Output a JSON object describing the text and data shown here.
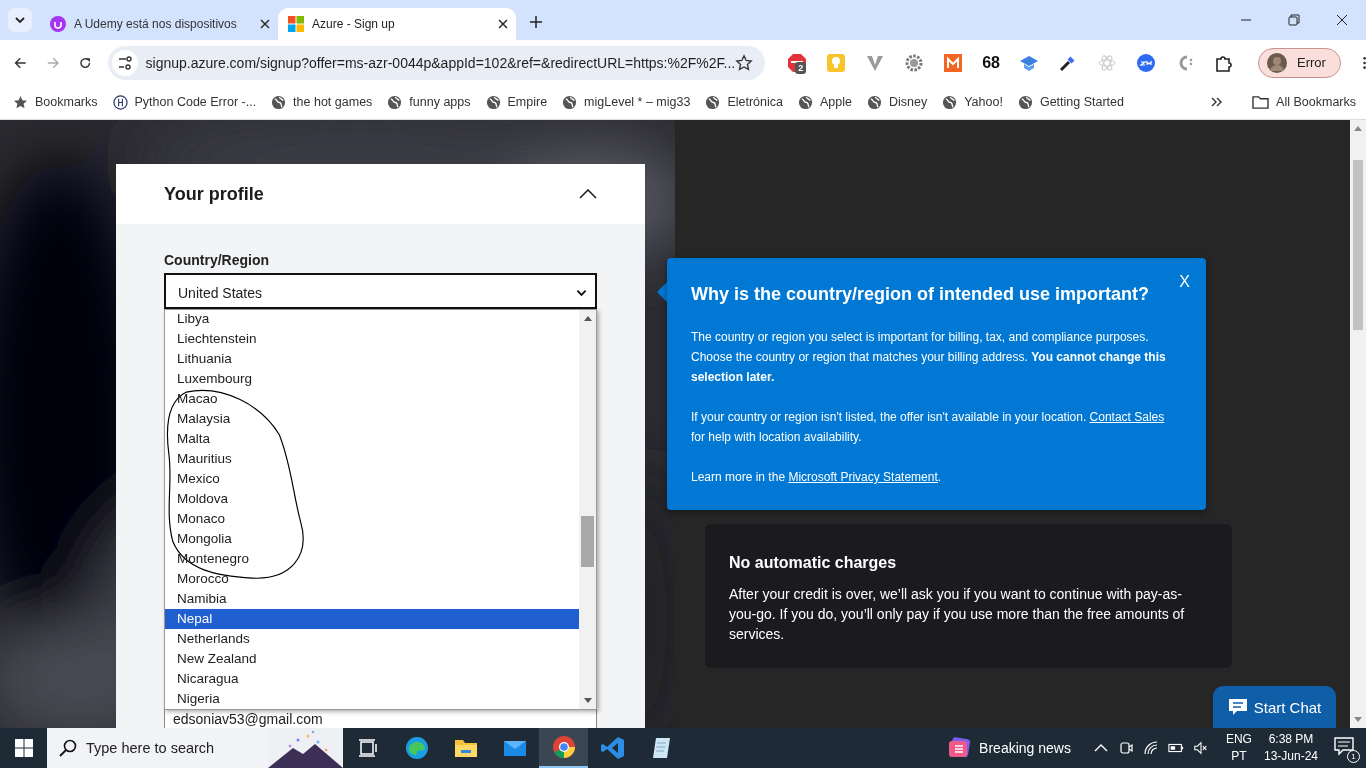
{
  "browser": {
    "tabs": [
      {
        "title": "A Udemy está nos dispositivos",
        "selected": false
      },
      {
        "title": "Azure - Sign up",
        "selected": true
      }
    ],
    "forward_enabled": false,
    "url": "signup.azure.com/signup?offer=ms-azr-0044p&appId=102&ref=&redirectURL=https:%2F%2F...",
    "extensions": [
      {
        "kind": "abp",
        "badge": "2"
      },
      {
        "kind": "bulb"
      },
      {
        "kind": "vee"
      },
      {
        "kind": "gear"
      },
      {
        "kind": "m"
      },
      {
        "kind": "count",
        "text": "68"
      },
      {
        "kind": "cap"
      },
      {
        "kind": "dropper"
      },
      {
        "kind": "atom"
      },
      {
        "kind": "zm"
      },
      {
        "kind": "c"
      },
      {
        "kind": "puzzle"
      }
    ],
    "profile": "Error",
    "bookmarks": [
      {
        "label": "Bookmarks"
      },
      {
        "label": "Python Code Error -..."
      },
      {
        "label": "the hot games"
      },
      {
        "label": "funny apps"
      },
      {
        "label": "Empire"
      },
      {
        "label": "migLevel * – mig33"
      },
      {
        "label": "Eletrónica"
      },
      {
        "label": "Apple"
      },
      {
        "label": "Disney"
      },
      {
        "label": "Yahoo!"
      },
      {
        "label": "Getting Started"
      }
    ],
    "all_bookmarks": "All Bookmarks"
  },
  "page": {
    "profile_section": {
      "title": "Your profile",
      "expanded": true
    },
    "country_label": "Country/Region",
    "country_value": "United States",
    "options": [
      {
        "label": "Libya",
        "selected": false
      },
      {
        "label": "Liechtenstein",
        "selected": false
      },
      {
        "label": "Lithuania",
        "selected": false
      },
      {
        "label": "Luxembourg",
        "selected": false
      },
      {
        "label": "Macao",
        "selected": false
      },
      {
        "label": "Malaysia",
        "selected": false
      },
      {
        "label": "Malta",
        "selected": false
      },
      {
        "label": "Mauritius",
        "selected": false
      },
      {
        "label": "Mexico",
        "selected": false
      },
      {
        "label": "Moldova",
        "selected": false
      },
      {
        "label": "Monaco",
        "selected": false
      },
      {
        "label": "Mongolia",
        "selected": false
      },
      {
        "label": "Montenegro",
        "selected": false
      },
      {
        "label": "Morocco",
        "selected": false
      },
      {
        "label": "Namibia",
        "selected": false
      },
      {
        "label": "Nepal",
        "selected": true
      },
      {
        "label": "Netherlands",
        "selected": false
      },
      {
        "label": "New Zealand",
        "selected": false
      },
      {
        "label": "Nicaragua",
        "selected": false
      },
      {
        "label": "Nigeria",
        "selected": false
      }
    ],
    "email_value": "edsoniav53@gmail.com",
    "popover": {
      "title": "Why is the country/region of intended use important?",
      "close": "X",
      "paragraph_1": "The country or region you select is important for billing, tax, and compliance purposes. Choose the country or region that matches your billing address. **You cannot change this selection later.**",
      "paragraph_2": {
        "before": "If your country or region isn't listed, the offer isn't available in your location. ",
        "link": "Contact Sales",
        "after": " for help with location availability."
      },
      "paragraph_3": {
        "before": "Learn more in the ",
        "link": "Microsoft Privacy Statement",
        "after": "."
      }
    },
    "card": {
      "title": "No automatic charges",
      "body": "After your credit is over, we’ll ask you if you want to continue with pay-as-you-go. If you do, you’ll only pay if you use more than the free amounts of services."
    },
    "chat_button": "Start Chat"
  },
  "taskbar": {
    "search_placeholder": "Type here to search",
    "apps": [
      {
        "kind": "taskview",
        "active": false
      },
      {
        "kind": "edge",
        "active": false
      },
      {
        "kind": "folder",
        "active": false
      },
      {
        "kind": "mail",
        "active": false
      },
      {
        "kind": "chrome",
        "active": true
      },
      {
        "kind": "vscode",
        "active": false
      },
      {
        "kind": "notepad",
        "active": false
      }
    ],
    "news": "Breaking news",
    "language": "ENG",
    "keyboard": "PT",
    "time": "6:38 PM",
    "date": "13-Jun-24",
    "notifications": "1"
  }
}
